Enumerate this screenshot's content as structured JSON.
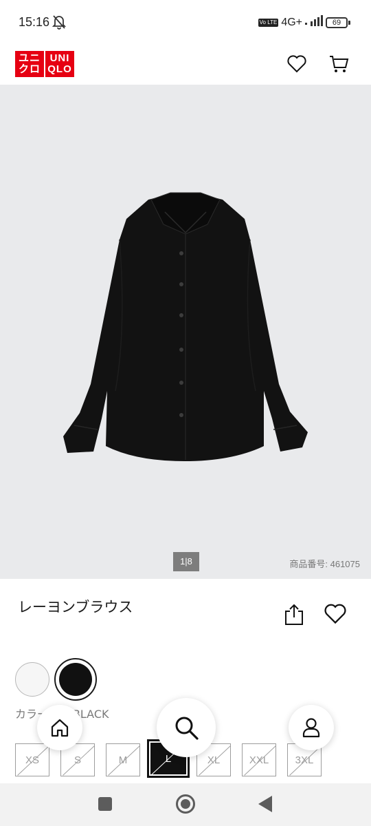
{
  "status_bar": {
    "time": "15:16",
    "network": "4G+",
    "volte": "Vo LTE",
    "battery": "69"
  },
  "header": {
    "logo_line1_left": "ユニ",
    "logo_line2_left": "クロ",
    "logo_line1_right": "UNI",
    "logo_line2_right": "QLO",
    "logo_color": "#e60012",
    "icons": [
      "heart-icon",
      "cart-icon"
    ]
  },
  "product": {
    "image_pager": "1|8",
    "sku": "商品番号: 461075",
    "title": "レーヨンブラウス",
    "color_label": "カラー: 09 BLACK",
    "colors": [
      {
        "name": "white",
        "hex": "#f6f6f6"
      },
      {
        "name": "black",
        "hex": "#111111",
        "selected": true
      }
    ],
    "sizes": [
      {
        "label": "XS",
        "available": false
      },
      {
        "label": "S",
        "available": false
      },
      {
        "label": "M",
        "available": false
      },
      {
        "label": "L",
        "available": false,
        "selected": true
      },
      {
        "label": "XL",
        "available": false
      },
      {
        "label": "XXL",
        "available": false
      },
      {
        "label": "3XL",
        "available": false
      }
    ]
  },
  "bottom_nav": {
    "icons": [
      "home-icon",
      "search-icon",
      "user-icon"
    ]
  }
}
